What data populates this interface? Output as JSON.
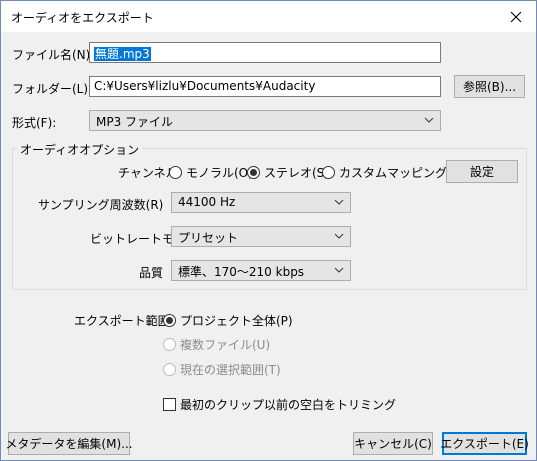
{
  "window": {
    "title": "オーディオをエクスポート"
  },
  "file_name": {
    "label": "ファイル名(N):",
    "value": "無題.mp3"
  },
  "folder": {
    "label": "フォルダー(L):",
    "value": "C:¥Users¥lizlu¥Documents¥Audacity",
    "browse_label": "参照(B)..."
  },
  "format": {
    "label": "形式(F):",
    "value": "MP3 ファイル"
  },
  "audio_options": {
    "title": "オーディオオプション",
    "channels": {
      "label": "チャンネル",
      "options": [
        "モノラル(O)",
        "ステレオ(S)",
        "カスタムマッピング(G)"
      ],
      "selected": "ステレオ(S)",
      "settings_label": "設定"
    },
    "sample_rate": {
      "label": "サンプリング周波数(R)",
      "value": "44100 Hz"
    },
    "bitrate_mode": {
      "label": "ビットレートモード",
      "value": "プリセット"
    },
    "quality": {
      "label": "品質",
      "value": "標準、170〜210 kbps"
    }
  },
  "export_range": {
    "label": "エクスポート範囲:",
    "options": [
      "プロジェクト全体(P)",
      "複数ファイル(U)",
      "現在の選択範囲(T)"
    ],
    "selected": "プロジェクト全体(P)"
  },
  "trim": {
    "label": "最初のクリップ以前の空白をトリミング",
    "checked": false
  },
  "buttons": {
    "metadata": "メタデータを編集(M)...",
    "cancel": "キャンセル(C)",
    "export": "エクスポート(E)"
  }
}
